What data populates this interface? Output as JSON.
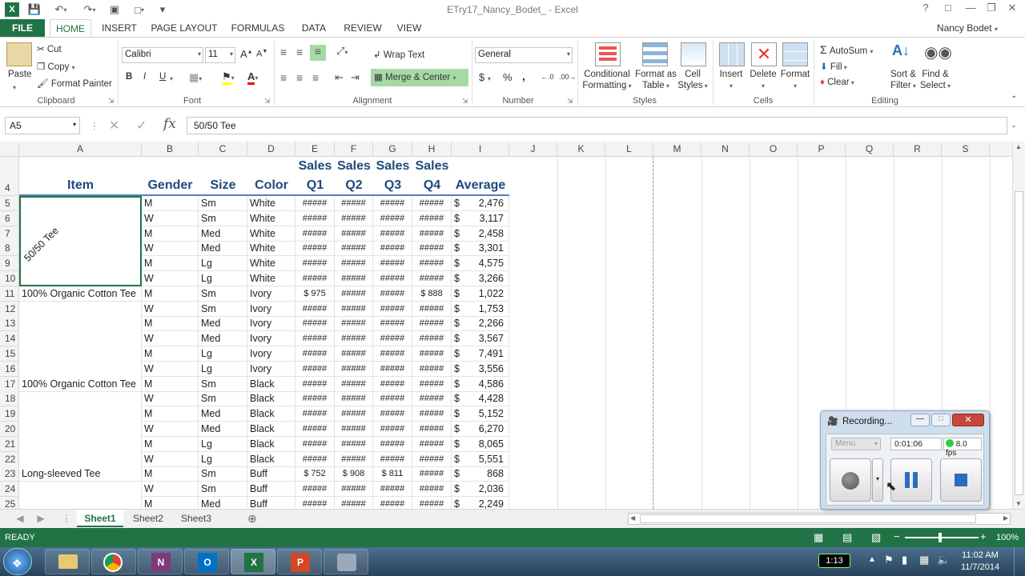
{
  "window": {
    "title": "ETry17_Nancy_Bodet_ - Excel"
  },
  "tabs": [
    {
      "label": "FILE"
    },
    {
      "label": "HOME"
    },
    {
      "label": "INSERT"
    },
    {
      "label": "PAGE LAYOUT"
    },
    {
      "label": "FORMULAS"
    },
    {
      "label": "DATA"
    },
    {
      "label": "REVIEW"
    },
    {
      "label": "VIEW"
    }
  ],
  "user": "Nancy Bodet",
  "ribbon": {
    "clipboard": {
      "paste": "Paste",
      "cut": "Cut",
      "copy": "Copy",
      "format_painter": "Format Painter",
      "label": "Clipboard"
    },
    "font": {
      "name": "Calibri",
      "size": "11",
      "label": "Font",
      "bold": "B",
      "italic": "I",
      "underline": "U"
    },
    "alignment": {
      "wrap": "Wrap Text",
      "merge": "Merge & Center",
      "label": "Alignment"
    },
    "number": {
      "format": "General",
      "label": "Number",
      "currency": "$",
      "percent": "%",
      "comma": ","
    },
    "styles": {
      "conditional": "Conditional",
      "conditional2": "Formatting",
      "format_as": "Format as",
      "format_as2": "Table",
      "cell": "Cell",
      "cell2": "Styles",
      "label": "Styles"
    },
    "cells": {
      "insert": "Insert",
      "delete": "Delete",
      "format": "Format",
      "label": "Cells"
    },
    "editing": {
      "autosum": "AutoSum",
      "fill": "Fill",
      "clear": "Clear",
      "sort": "Sort &",
      "sort2": "Filter",
      "find": "Find &",
      "find2": "Select",
      "label": "Editing"
    }
  },
  "formula_bar": {
    "name_box": "A5",
    "fx": "fx",
    "content": "50/50 Tee"
  },
  "columns": [
    "A",
    "B",
    "C",
    "D",
    "E",
    "F",
    "G",
    "H",
    "I",
    "J",
    "K",
    "L",
    "M",
    "N",
    "O",
    "P",
    "Q",
    "R",
    "S"
  ],
  "headers": {
    "row": "4",
    "item": "Item",
    "gender": "Gender",
    "size": "Size",
    "color": "Color",
    "q1a": "Sales",
    "q1b": "Q1",
    "q2a": "Sales",
    "q2b": "Q2",
    "q3a": "Sales",
    "q3b": "Q3",
    "q4a": "Sales",
    "q4b": "Q4",
    "avg": "Average"
  },
  "rotated_item": "50/50 Tee",
  "rows": [
    {
      "n": "5",
      "a": "",
      "b": "M",
      "c": "Sm",
      "d": "White",
      "e": "#####",
      "f": "#####",
      "g": "#####",
      "h": "#####",
      "i": "2,476"
    },
    {
      "n": "6",
      "a": "",
      "b": "W",
      "c": "Sm",
      "d": "White",
      "e": "#####",
      "f": "#####",
      "g": "#####",
      "h": "#####",
      "i": "3,117"
    },
    {
      "n": "7",
      "a": "",
      "b": "M",
      "c": "Med",
      "d": "White",
      "e": "#####",
      "f": "#####",
      "g": "#####",
      "h": "#####",
      "i": "2,458"
    },
    {
      "n": "8",
      "a": "",
      "b": "W",
      "c": "Med",
      "d": "White",
      "e": "#####",
      "f": "#####",
      "g": "#####",
      "h": "#####",
      "i": "3,301"
    },
    {
      "n": "9",
      "a": "",
      "b": "M",
      "c": "Lg",
      "d": "White",
      "e": "#####",
      "f": "#####",
      "g": "#####",
      "h": "#####",
      "i": "4,575"
    },
    {
      "n": "10",
      "a": "",
      "b": "W",
      "c": "Lg",
      "d": "White",
      "e": "#####",
      "f": "#####",
      "g": "#####",
      "h": "#####",
      "i": "3,266"
    },
    {
      "n": "11",
      "a": "100% Organic Cotton Tee",
      "b": "M",
      "c": "Sm",
      "d": "Ivory",
      "e": "$ 975",
      "f": "#####",
      "g": "#####",
      "h": "$ 888",
      "i": "1,022"
    },
    {
      "n": "12",
      "a": "",
      "b": "W",
      "c": "Sm",
      "d": "Ivory",
      "e": "#####",
      "f": "#####",
      "g": "#####",
      "h": "#####",
      "i": "1,753"
    },
    {
      "n": "13",
      "a": "",
      "b": "M",
      "c": "Med",
      "d": "Ivory",
      "e": "#####",
      "f": "#####",
      "g": "#####",
      "h": "#####",
      "i": "2,266"
    },
    {
      "n": "14",
      "a": "",
      "b": "W",
      "c": "Med",
      "d": "Ivory",
      "e": "#####",
      "f": "#####",
      "g": "#####",
      "h": "#####",
      "i": "3,567"
    },
    {
      "n": "15",
      "a": "",
      "b": "M",
      "c": "Lg",
      "d": "Ivory",
      "e": "#####",
      "f": "#####",
      "g": "#####",
      "h": "#####",
      "i": "7,491"
    },
    {
      "n": "16",
      "a": "",
      "b": "W",
      "c": "Lg",
      "d": "Ivory",
      "e": "#####",
      "f": "#####",
      "g": "#####",
      "h": "#####",
      "i": "3,556"
    },
    {
      "n": "17",
      "a": "100% Organic Cotton Tee",
      "b": "M",
      "c": "Sm",
      "d": "Black",
      "e": "#####",
      "f": "#####",
      "g": "#####",
      "h": "#####",
      "i": "4,586"
    },
    {
      "n": "18",
      "a": "",
      "b": "W",
      "c": "Sm",
      "d": "Black",
      "e": "#####",
      "f": "#####",
      "g": "#####",
      "h": "#####",
      "i": "4,428"
    },
    {
      "n": "19",
      "a": "",
      "b": "M",
      "c": "Med",
      "d": "Black",
      "e": "#####",
      "f": "#####",
      "g": "#####",
      "h": "#####",
      "i": "5,152"
    },
    {
      "n": "20",
      "a": "",
      "b": "W",
      "c": "Med",
      "d": "Black",
      "e": "#####",
      "f": "#####",
      "g": "#####",
      "h": "#####",
      "i": "6,270"
    },
    {
      "n": "21",
      "a": "",
      "b": "M",
      "c": "Lg",
      "d": "Black",
      "e": "#####",
      "f": "#####",
      "g": "#####",
      "h": "#####",
      "i": "8,065"
    },
    {
      "n": "22",
      "a": "",
      "b": "W",
      "c": "Lg",
      "d": "Black",
      "e": "#####",
      "f": "#####",
      "g": "#####",
      "h": "#####",
      "i": "5,551"
    },
    {
      "n": "23",
      "a": "Long-sleeved Tee",
      "b": "M",
      "c": "Sm",
      "d": "Buff",
      "e": "$ 752",
      "f": "$ 908",
      "g": "$ 811",
      "h": "#####",
      "i": "868"
    },
    {
      "n": "24",
      "a": "",
      "b": "W",
      "c": "Sm",
      "d": "Buff",
      "e": "#####",
      "f": "#####",
      "g": "#####",
      "h": "#####",
      "i": "2,036"
    },
    {
      "n": "25",
      "a": "",
      "b": "M",
      "c": "Med",
      "d": "Buff",
      "e": "#####",
      "f": "#####",
      "g": "#####",
      "h": "#####",
      "i": "2,249"
    }
  ],
  "dollar": "$",
  "sheets": [
    {
      "label": "Sheet1"
    },
    {
      "label": "Sheet2"
    },
    {
      "label": "Sheet3"
    }
  ],
  "status": {
    "ready": "READY",
    "zoom": "100%"
  },
  "recorder": {
    "title": "Recording...",
    "menu": "Menu",
    "time": "0:01:06",
    "fps": "8.0 fps"
  },
  "taskbar": {
    "badge": "1:13",
    "time": "11:02 AM",
    "date": "11/7/2014"
  },
  "colors": {
    "excel_green": "#217346",
    "header_blue": "#1f497d"
  }
}
